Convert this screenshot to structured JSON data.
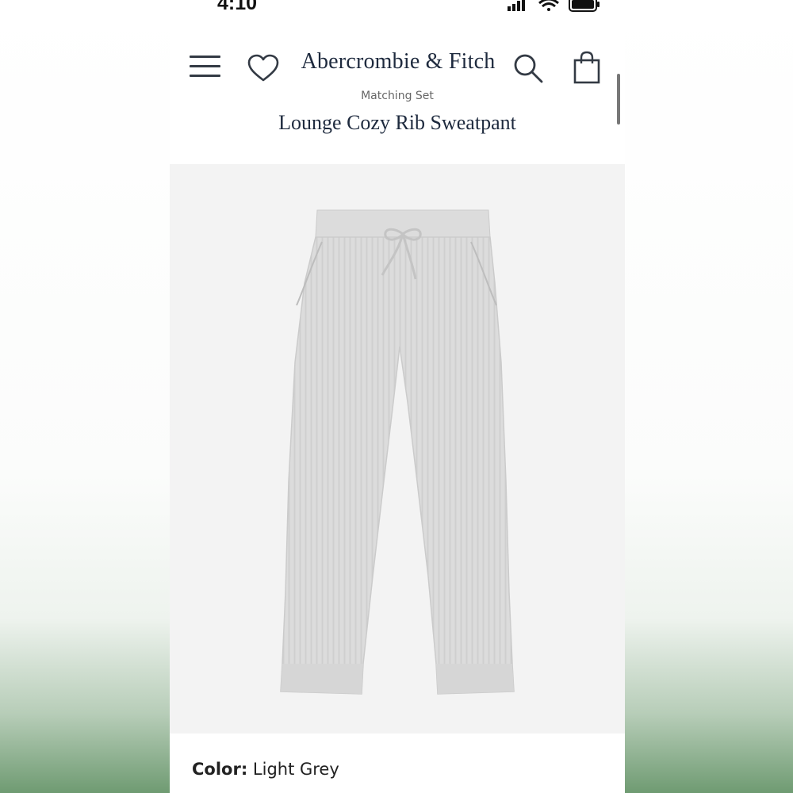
{
  "status": {
    "time": "4:10"
  },
  "header": {
    "brand": "Abercrombie & Fitch"
  },
  "product": {
    "subtitle": "Matching Set",
    "title": "Lounge Cozy Rib Sweatpant",
    "image_description": "Light grey ribbed jogger sweatpant with drawstring waist",
    "color_label": "Color:",
    "color_value": "Light Grey"
  },
  "icons": {
    "menu": "menu-icon",
    "favorite": "heart-icon",
    "search": "search-icon",
    "bag": "shopping-bag-icon",
    "signal": "signal-icon",
    "wifi": "wifi-icon",
    "battery": "battery-icon"
  },
  "colors": {
    "brand_text": "#1e2a3e",
    "image_bg": "#f3f3f3",
    "garment": "#dcdcdc"
  }
}
